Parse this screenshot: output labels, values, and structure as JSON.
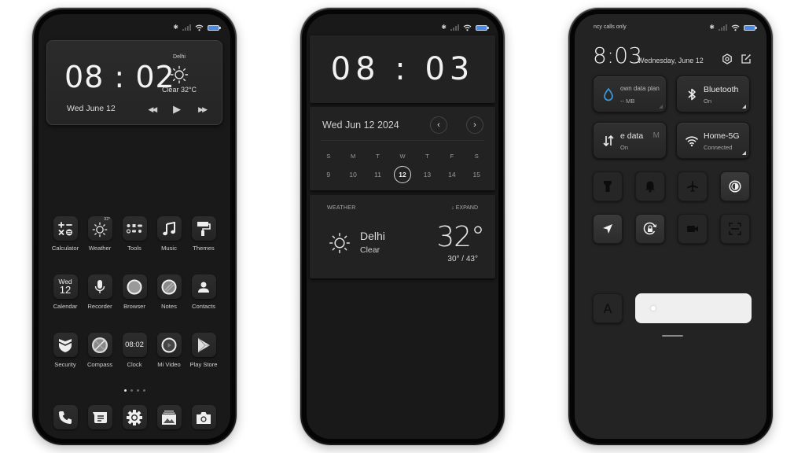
{
  "status_bar": {
    "bluetooth": "bluetooth-icon",
    "signal": "signal-icon",
    "wifi": "wifi-icon",
    "battery": "battery-icon",
    "battery_color": "#4a8be8"
  },
  "phone1": {
    "widget": {
      "time": "08 : 02",
      "city": "Delhi",
      "condition": "Clear 32°C",
      "date": "Wed June 12",
      "media": {
        "previous": "◀◀",
        "play": "▶",
        "next": "▶▶"
      }
    },
    "apps": [
      {
        "label": "Calculator",
        "icon": "calculator-icon"
      },
      {
        "label": "Weather",
        "icon": "weather-icon",
        "badge": "32°"
      },
      {
        "label": "Tools",
        "icon": "tools-icon"
      },
      {
        "label": "Music",
        "icon": "music-note-icon",
        "glyph": "♫"
      },
      {
        "label": "Themes",
        "icon": "paint-roller-icon"
      },
      {
        "label": "Calendar",
        "icon": "calendar-icon",
        "day": "Wed",
        "date": "12"
      },
      {
        "label": "Recorder",
        "icon": "microphone-icon"
      },
      {
        "label": "Browser",
        "icon": "browser-icon"
      },
      {
        "label": "Notes",
        "icon": "notes-icon"
      },
      {
        "label": "Contacts",
        "icon": "contacts-icon"
      },
      {
        "label": "Security",
        "icon": "shield-icon"
      },
      {
        "label": "Compass",
        "icon": "compass-icon"
      },
      {
        "label": "Clock",
        "icon": "clock-icon",
        "time": "08:02"
      },
      {
        "label": "Mi Video",
        "icon": "video-play-icon"
      },
      {
        "label": "Play Store",
        "icon": "play-store-icon"
      }
    ],
    "page_indicator": {
      "pages": 4,
      "current": 1
    },
    "dock": [
      {
        "name": "phone",
        "icon": "phone-icon"
      },
      {
        "name": "messages",
        "icon": "message-icon"
      },
      {
        "name": "settings",
        "icon": "gear-icon"
      },
      {
        "name": "gallery",
        "icon": "gallery-icon"
      },
      {
        "name": "camera",
        "icon": "camera-icon"
      }
    ]
  },
  "phone2": {
    "clock": "08 : 03",
    "calendar": {
      "title": "Wed Jun 12 2024",
      "prev": "‹",
      "next": "›",
      "weekdays": [
        "S",
        "M",
        "T",
        "W",
        "T",
        "F",
        "S"
      ],
      "days": [
        "9",
        "10",
        "11",
        "12",
        "13",
        "14",
        "15"
      ],
      "selected": "12"
    },
    "weather": {
      "label": "WEATHER",
      "expand": "↓ EXPAND",
      "city": "Delhi",
      "condition": "Clear",
      "temp": "32°",
      "range": "30° / 43°"
    }
  },
  "phone3": {
    "carrier": "ncy calls only",
    "time": "8:03",
    "date": "Wednesday, June 12",
    "tiles": [
      {
        "title": "own data plan",
        "sub": "-- MB",
        "icon": "water-drop-icon",
        "accent": "#3a9be0"
      },
      {
        "title": "Bluetooth",
        "sub": "On",
        "icon": "bluetooth-icon"
      },
      {
        "title": "e data",
        "sub": "On",
        "icon": "data-transfer-icon",
        "trail": "M"
      },
      {
        "title": "Home-5G",
        "sub": "Connected",
        "icon": "wifi-icon"
      }
    ],
    "toggles": [
      {
        "name": "flashlight",
        "icon": "flashlight-icon",
        "on": false
      },
      {
        "name": "mute",
        "icon": "bell-icon",
        "on": false
      },
      {
        "name": "airplane-mode",
        "icon": "airplane-icon",
        "on": false
      },
      {
        "name": "dark-mode",
        "icon": "contrast-icon",
        "on": true
      },
      {
        "name": "location",
        "icon": "location-arrow-icon",
        "on": true
      },
      {
        "name": "rotation-lock",
        "icon": "rotation-lock-icon",
        "on": true
      },
      {
        "name": "screen-record",
        "icon": "video-camera-icon",
        "on": false
      },
      {
        "name": "scanner",
        "icon": "scan-icon",
        "on": false
      }
    ],
    "auto_brightness_label": "A",
    "brightness": 0.05
  }
}
